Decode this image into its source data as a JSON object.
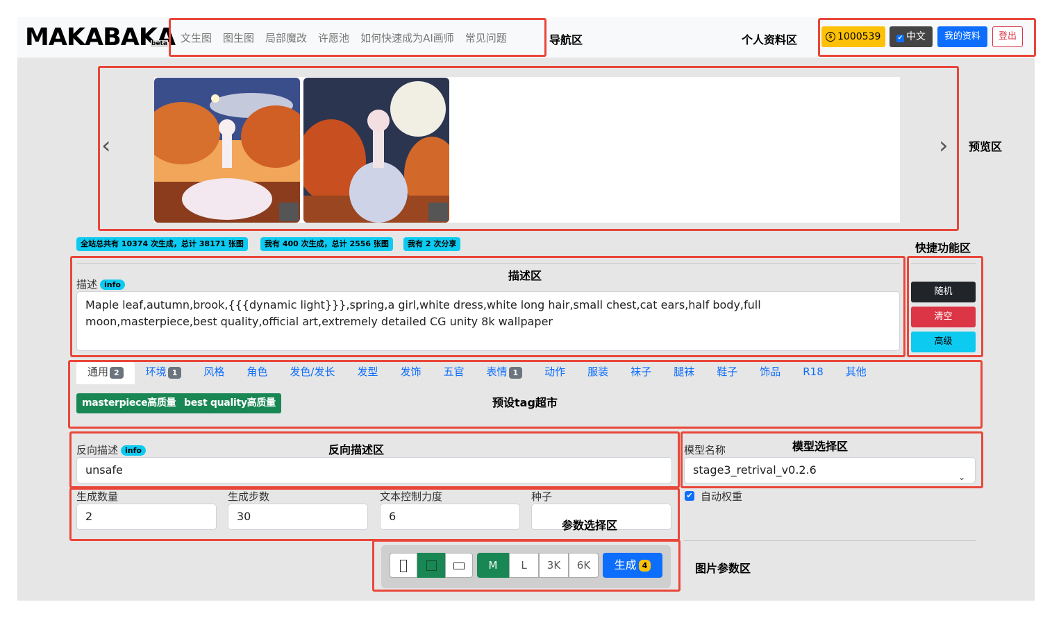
{
  "navbar": {
    "logo": "MAKABAKA",
    "logo_suffix": "beta",
    "links": [
      "文生图",
      "图生图",
      "局部魔改",
      "许愿池",
      "如何快速成为AI画师",
      "常见问题"
    ],
    "coins": "1000539",
    "lang_label": "中文",
    "profile_label": "我的资料",
    "logout_label": "登出"
  },
  "annotations": {
    "nav": "导航区",
    "profile": "个人资料区",
    "preview": "预览区",
    "shortcut": "快捷功能区",
    "desc": "描述区",
    "tags": "预设tag超市",
    "neg": "反向描述区",
    "model": "模型选择区",
    "params": "参数选择区",
    "image_params": "图片参数区"
  },
  "stats": [
    "全站总共有 10374 次生成，总计 38171 张图",
    "我有 400 次生成，总计 2556 张图",
    "我有 2 次分享"
  ],
  "prompt": {
    "label": "描述",
    "info": "info",
    "value": "Maple leaf,autumn,brook,{{{dynamic light}}},spring,a girl,white dress,white long hair,small chest,cat ears,half body,full moon,masterpiece,best quality,official art,extremely detailed CG unity 8k wallpaper"
  },
  "side_buttons": {
    "random": "随机",
    "clear": "清空",
    "advanced": "高级"
  },
  "tabs": [
    {
      "label": "通用",
      "count": "2"
    },
    {
      "label": "环境",
      "count": "1"
    },
    {
      "label": "风格",
      "count": ""
    },
    {
      "label": "角色",
      "count": ""
    },
    {
      "label": "发色/发长",
      "count": ""
    },
    {
      "label": "发型",
      "count": ""
    },
    {
      "label": "发饰",
      "count": ""
    },
    {
      "label": "五官",
      "count": ""
    },
    {
      "label": "表情",
      "count": "1"
    },
    {
      "label": "动作",
      "count": ""
    },
    {
      "label": "服装",
      "count": ""
    },
    {
      "label": "袜子",
      "count": ""
    },
    {
      "label": "腿袜",
      "count": ""
    },
    {
      "label": "鞋子",
      "count": ""
    },
    {
      "label": "饰品",
      "count": ""
    },
    {
      "label": "R18",
      "count": ""
    },
    {
      "label": "其他",
      "count": ""
    }
  ],
  "preset_tags": [
    "masterpiece高质量",
    "best quality高质量"
  ],
  "negative": {
    "label": "反向描述",
    "info": "info",
    "value": "unsafe"
  },
  "model": {
    "label": "模型名称",
    "value": "stage3_retrival_v0.2.6"
  },
  "params": {
    "count_label": "生成数量",
    "count": "2",
    "steps_label": "生成步数",
    "steps": "30",
    "cfg_label": "文本控制力度",
    "cfg": "6",
    "seed_label": "种子",
    "seed": "",
    "auto_weight_label": "自动权重"
  },
  "image_params": {
    "sizes": [
      "M",
      "L",
      "3K",
      "6K"
    ],
    "selected_size": "M",
    "generate_label": "生成",
    "generate_count": "4"
  }
}
